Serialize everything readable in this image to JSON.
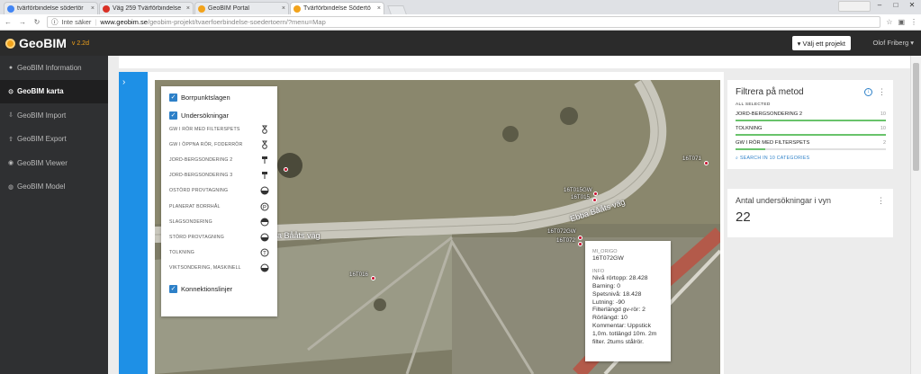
{
  "browser": {
    "tabs": [
      {
        "title": "tvärförbindelse södertör",
        "active": false,
        "color": "#4285f4"
      },
      {
        "title": "Väg 259 Tvärförbindelse",
        "active": false,
        "color": "#d93025"
      },
      {
        "title": "GeoBIM Portal",
        "active": false,
        "color": "#f2a31b"
      },
      {
        "title": "Tvärförbindelse Södertö",
        "active": true,
        "color": "#f2a31b"
      }
    ],
    "close_glyph": "×",
    "address": {
      "insecure_label": "Inte säker",
      "host": "www.geobim.se",
      "path": "/geobim-projekt/tvaerfoerbindelse-soedertoern/?menu=Map"
    }
  },
  "app": {
    "logo": "GeoBIM",
    "version": "v 2.2d",
    "project_button": "▾ Välj ett projekt",
    "user": "Olof Friberg ▾",
    "accent": "#f2a31b"
  },
  "sidebar": {
    "items": [
      {
        "label": "GeoBIM Information",
        "icon": "info-icon",
        "glyph": "●",
        "active": false
      },
      {
        "label": "GeoBIM karta",
        "icon": "map-icon",
        "glyph": "⊙",
        "active": true
      },
      {
        "label": "GeoBIM Import",
        "icon": "import-icon",
        "glyph": "⇩",
        "active": false
      },
      {
        "label": "GeoBIM Export",
        "icon": "export-icon",
        "glyph": "⇧",
        "active": false
      },
      {
        "label": "GeoBIM Viewer",
        "icon": "viewer-icon",
        "glyph": "◉",
        "active": false
      },
      {
        "label": "GeoBIM Model",
        "icon": "model-icon",
        "glyph": "◍",
        "active": false
      }
    ]
  },
  "legend": {
    "borrpunkt_label": "Borrpunktslagen",
    "undersokningar_label": "Undersökningar",
    "items": [
      "GW I RÖR MED FILTERSPETS",
      "GW I ÖPPNA RÖR, FODERRÖR",
      "JORD-BERGSONDERING 2",
      "JORD-BERGSONDERING 3",
      "OSTÖRD PROVTAGNING",
      "PLANERAT BORRHÅL",
      "SLAGSONDERING",
      "STÖRD PROVTAGNING",
      "TOLKNING",
      "VIKTSONDERING, MASKINELL"
    ],
    "konnektion_label": "Konnektionslinjer"
  },
  "map": {
    "road_labels": [
      "Ebba Bååts väg",
      "Ebba Bååts väg"
    ],
    "pins": [
      "16T071",
      "16T015GW",
      "16T015",
      "16T072GW",
      "16T072",
      "16T016"
    ]
  },
  "popup": {
    "source": "MI_ORIGO",
    "id": "16T072GW",
    "section": "INFO",
    "lines": [
      "Nivå rörtopp: 28.428",
      "Barning: 0",
      "Spetsnivå: 18.428",
      "Lutning: -90",
      "Filterlängd gv-rör: 2",
      "Rörlängd: 10",
      "Kommentar: Uppstick 1,0m. totlängd 10m. 2m filter. 2tums stålrör."
    ]
  },
  "filter_panel": {
    "title": "Filtrera på metod",
    "all_selected": "ALL SELECTED",
    "items": [
      {
        "label": "JORD-BERGSONDERING 2",
        "count": "10",
        "fraction": 1.0
      },
      {
        "label": "TOLKNING",
        "count": "10",
        "fraction": 1.0
      },
      {
        "label": "GW I RÖR MED FILTERSPETS",
        "count": "2",
        "fraction": 0.2
      }
    ],
    "search_label": "SEARCH IN 10 CATEGORIES"
  },
  "count_panel": {
    "title": "Antal undersökningar i vyn",
    "value": "22"
  }
}
